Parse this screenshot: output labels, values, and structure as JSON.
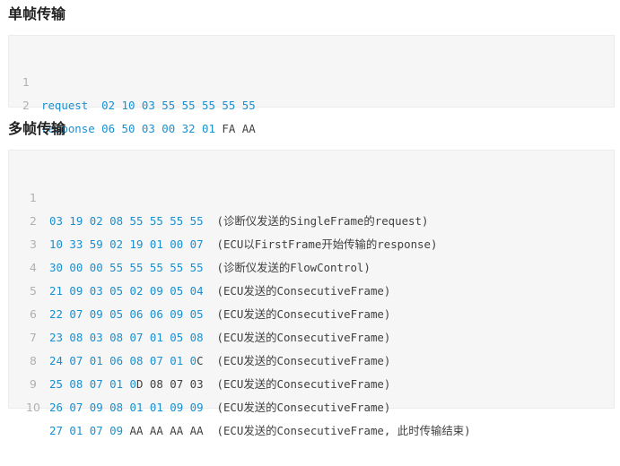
{
  "section1": {
    "title": "单帧传输",
    "lines": [
      {
        "no": "1",
        "blue": "request  02 10 03 55 55 55 55 55",
        "plain": "",
        "comment": ""
      },
      {
        "no": "2",
        "blue": "response 06 50 03 00 32 01",
        "plain": " FA AA",
        "comment": ""
      }
    ]
  },
  "section2": {
    "title": "多帧传输",
    "lines": [
      {
        "no": "1",
        "blue": "03 19 02 08 55 55 55 55",
        "plain": "",
        "comment": "  (诊断仪发送的SingleFrame的request)"
      },
      {
        "no": "2",
        "blue": "10 33 59 02 19 01 00 07",
        "plain": "",
        "comment": "  (ECU以FirstFrame开始传输的response)"
      },
      {
        "no": "3",
        "blue": "30 00 00 55 55 55 55 55",
        "plain": "",
        "comment": "  (诊断仪发送的FlowControl)"
      },
      {
        "no": "4",
        "blue": "21 09 03 05 02 09 05 04",
        "plain": "",
        "comment": "  (ECU发送的ConsecutiveFrame)"
      },
      {
        "no": "5",
        "blue": "22 07 09 05 06 06 09 05",
        "plain": "",
        "comment": "  (ECU发送的ConsecutiveFrame)"
      },
      {
        "no": "6",
        "blue": "23 08 03 08 07 01 05 08",
        "plain": "",
        "comment": "  (ECU发送的ConsecutiveFrame)"
      },
      {
        "no": "7",
        "blue": "24 07 01 06 08 07 01 0",
        "plain": "C",
        "comment": "  (ECU发送的ConsecutiveFrame)"
      },
      {
        "no": "8",
        "blue": "25 08 07 01 0",
        "plain": "D 08 07 03",
        "comment": "  (ECU发送的ConsecutiveFrame)"
      },
      {
        "no": "9",
        "blue": "26 07 09 08 01 01 09 09",
        "plain": "",
        "comment": "  (ECU发送的ConsecutiveFrame)"
      },
      {
        "no": "10",
        "blue": "27 01 07 09",
        "plain": " AA AA AA AA",
        "comment": "  (ECU发送的ConsecutiveFrame, 此时传输结束)"
      }
    ]
  },
  "colors": {
    "accent_blue": "#1a8fd0",
    "code_bg": "#f6f6f6",
    "line_number": "#b0b0b0",
    "text": "#404040"
  }
}
